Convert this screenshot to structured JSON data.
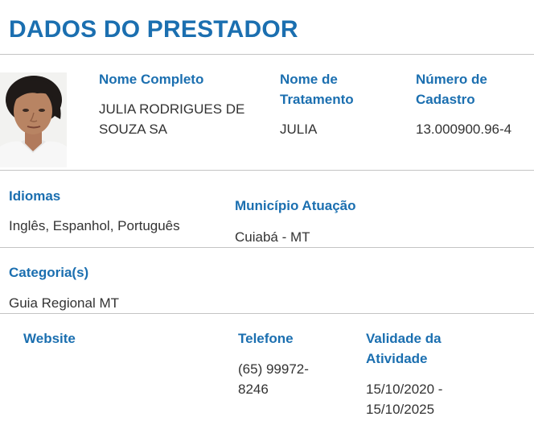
{
  "page": {
    "title": "DADOS DO PRESTADOR"
  },
  "provider": {
    "photo_alt": "Foto do prestador",
    "full_name": {
      "label": "Nome Completo",
      "value_line1": "JULIA RODRIGUES DE",
      "value_line2": "SOUZA SA"
    },
    "treatment_name": {
      "label_line1": "Nome de",
      "label_line2": "Tratamento",
      "value": "JULIA"
    },
    "registration": {
      "label_line1": "Número de",
      "label_line2": "Cadastro",
      "value": "13.000900.96-4"
    },
    "languages": {
      "label": "Idiomas",
      "value": "Inglês, Espanhol, Português"
    },
    "municipality": {
      "label": "Município Atuação",
      "value": "Cuiabá - MT"
    },
    "categories": {
      "label": "Categoria(s)",
      "value": "Guia Regional MT"
    },
    "website": {
      "label": "Website",
      "value": ""
    },
    "phone": {
      "label": "Telefone",
      "value_line1": "(65) 99972-",
      "value_line2": "8246"
    },
    "validity": {
      "label_line1": "Validade da",
      "label_line2": "Atividade",
      "value_line1": "15/10/2020 -",
      "value_line2": "15/10/2025"
    }
  },
  "colors": {
    "accent": "#1b6fb0",
    "text": "#333333",
    "divider": "#c4c4c4"
  }
}
